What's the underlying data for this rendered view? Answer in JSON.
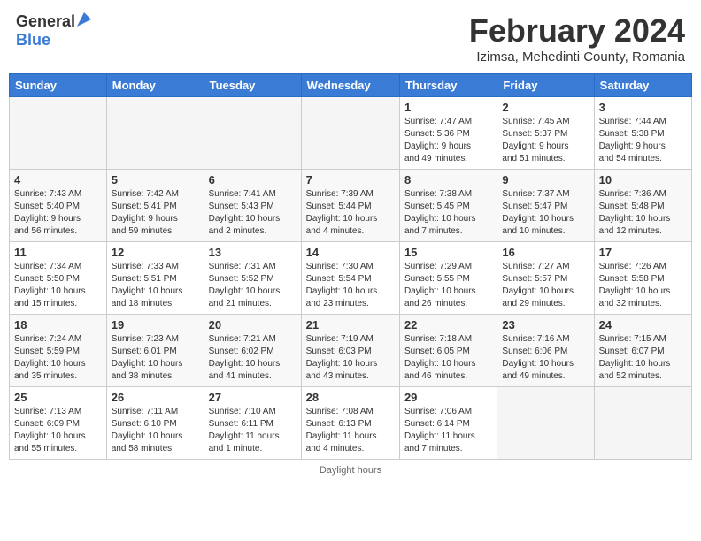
{
  "header": {
    "logo_general": "General",
    "logo_blue": "Blue",
    "title": "February 2024",
    "subtitle": "Izimsa, Mehedinti County, Romania"
  },
  "calendar": {
    "days_of_week": [
      "Sunday",
      "Monday",
      "Tuesday",
      "Wednesday",
      "Thursday",
      "Friday",
      "Saturday"
    ],
    "weeks": [
      [
        {
          "day": "",
          "info": ""
        },
        {
          "day": "",
          "info": ""
        },
        {
          "day": "",
          "info": ""
        },
        {
          "day": "",
          "info": ""
        },
        {
          "day": "1",
          "info": "Sunrise: 7:47 AM\nSunset: 5:36 PM\nDaylight: 9 hours\nand 49 minutes."
        },
        {
          "day": "2",
          "info": "Sunrise: 7:45 AM\nSunset: 5:37 PM\nDaylight: 9 hours\nand 51 minutes."
        },
        {
          "day": "3",
          "info": "Sunrise: 7:44 AM\nSunset: 5:38 PM\nDaylight: 9 hours\nand 54 minutes."
        }
      ],
      [
        {
          "day": "4",
          "info": "Sunrise: 7:43 AM\nSunset: 5:40 PM\nDaylight: 9 hours\nand 56 minutes."
        },
        {
          "day": "5",
          "info": "Sunrise: 7:42 AM\nSunset: 5:41 PM\nDaylight: 9 hours\nand 59 minutes."
        },
        {
          "day": "6",
          "info": "Sunrise: 7:41 AM\nSunset: 5:43 PM\nDaylight: 10 hours\nand 2 minutes."
        },
        {
          "day": "7",
          "info": "Sunrise: 7:39 AM\nSunset: 5:44 PM\nDaylight: 10 hours\nand 4 minutes."
        },
        {
          "day": "8",
          "info": "Sunrise: 7:38 AM\nSunset: 5:45 PM\nDaylight: 10 hours\nand 7 minutes."
        },
        {
          "day": "9",
          "info": "Sunrise: 7:37 AM\nSunset: 5:47 PM\nDaylight: 10 hours\nand 10 minutes."
        },
        {
          "day": "10",
          "info": "Sunrise: 7:36 AM\nSunset: 5:48 PM\nDaylight: 10 hours\nand 12 minutes."
        }
      ],
      [
        {
          "day": "11",
          "info": "Sunrise: 7:34 AM\nSunset: 5:50 PM\nDaylight: 10 hours\nand 15 minutes."
        },
        {
          "day": "12",
          "info": "Sunrise: 7:33 AM\nSunset: 5:51 PM\nDaylight: 10 hours\nand 18 minutes."
        },
        {
          "day": "13",
          "info": "Sunrise: 7:31 AM\nSunset: 5:52 PM\nDaylight: 10 hours\nand 21 minutes."
        },
        {
          "day": "14",
          "info": "Sunrise: 7:30 AM\nSunset: 5:54 PM\nDaylight: 10 hours\nand 23 minutes."
        },
        {
          "day": "15",
          "info": "Sunrise: 7:29 AM\nSunset: 5:55 PM\nDaylight: 10 hours\nand 26 minutes."
        },
        {
          "day": "16",
          "info": "Sunrise: 7:27 AM\nSunset: 5:57 PM\nDaylight: 10 hours\nand 29 minutes."
        },
        {
          "day": "17",
          "info": "Sunrise: 7:26 AM\nSunset: 5:58 PM\nDaylight: 10 hours\nand 32 minutes."
        }
      ],
      [
        {
          "day": "18",
          "info": "Sunrise: 7:24 AM\nSunset: 5:59 PM\nDaylight: 10 hours\nand 35 minutes."
        },
        {
          "day": "19",
          "info": "Sunrise: 7:23 AM\nSunset: 6:01 PM\nDaylight: 10 hours\nand 38 minutes."
        },
        {
          "day": "20",
          "info": "Sunrise: 7:21 AM\nSunset: 6:02 PM\nDaylight: 10 hours\nand 41 minutes."
        },
        {
          "day": "21",
          "info": "Sunrise: 7:19 AM\nSunset: 6:03 PM\nDaylight: 10 hours\nand 43 minutes."
        },
        {
          "day": "22",
          "info": "Sunrise: 7:18 AM\nSunset: 6:05 PM\nDaylight: 10 hours\nand 46 minutes."
        },
        {
          "day": "23",
          "info": "Sunrise: 7:16 AM\nSunset: 6:06 PM\nDaylight: 10 hours\nand 49 minutes."
        },
        {
          "day": "24",
          "info": "Sunrise: 7:15 AM\nSunset: 6:07 PM\nDaylight: 10 hours\nand 52 minutes."
        }
      ],
      [
        {
          "day": "25",
          "info": "Sunrise: 7:13 AM\nSunset: 6:09 PM\nDaylight: 10 hours\nand 55 minutes."
        },
        {
          "day": "26",
          "info": "Sunrise: 7:11 AM\nSunset: 6:10 PM\nDaylight: 10 hours\nand 58 minutes."
        },
        {
          "day": "27",
          "info": "Sunrise: 7:10 AM\nSunset: 6:11 PM\nDaylight: 11 hours\nand 1 minute."
        },
        {
          "day": "28",
          "info": "Sunrise: 7:08 AM\nSunset: 6:13 PM\nDaylight: 11 hours\nand 4 minutes."
        },
        {
          "day": "29",
          "info": "Sunrise: 7:06 AM\nSunset: 6:14 PM\nDaylight: 11 hours\nand 7 minutes."
        },
        {
          "day": "",
          "info": ""
        },
        {
          "day": "",
          "info": ""
        }
      ]
    ]
  },
  "footer": {
    "daylight_hours": "Daylight hours"
  }
}
